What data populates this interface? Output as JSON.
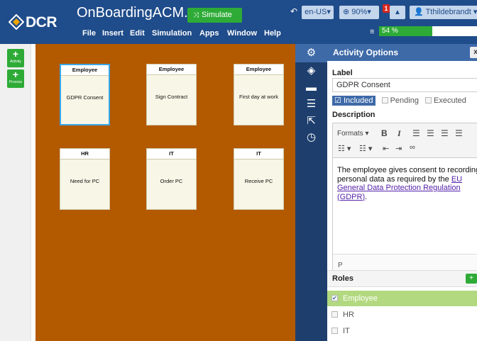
{
  "app": {
    "logo_text": "DCR",
    "title": "OnBoardingACM...",
    "simulate_label": "Simulate"
  },
  "menu": [
    "File",
    "Insert",
    "Edit",
    "Simulation",
    "Apps",
    "Window",
    "Help"
  ],
  "topbar": {
    "language": "en-US",
    "zoom": "90%",
    "notification_count": "1",
    "user": "Tthildebrandt",
    "progress_label": "54 %",
    "progress_value": 0.54
  },
  "left_tools": [
    {
      "label": "Activity"
    },
    {
      "label": "Process"
    }
  ],
  "activities": [
    {
      "role": "Employee",
      "label": "GDPR Consent",
      "selected": true
    },
    {
      "role": "Employee",
      "label": "Sign Contract",
      "selected": false
    },
    {
      "role": "Employee",
      "label": "First day at work",
      "selected": false
    },
    {
      "role": "HR",
      "label": "Need for PC",
      "selected": false
    },
    {
      "role": "IT",
      "label": "Order PC",
      "selected": false
    },
    {
      "role": "IT",
      "label": "Receive PC",
      "selected": false
    }
  ],
  "icon_column": [
    {
      "name": "gear-icon",
      "glyph": "⚙"
    },
    {
      "name": "hidden-eye-icon",
      "glyph": "◈"
    },
    {
      "name": "comment-icon",
      "glyph": "▬"
    },
    {
      "name": "list-icon",
      "glyph": "☰"
    },
    {
      "name": "share-icon",
      "glyph": "⇱"
    },
    {
      "name": "clock-icon",
      "glyph": "◷"
    }
  ],
  "panel": {
    "title": "Activity Options",
    "close_label": "x",
    "label_heading": "Label",
    "label_value": "GDPR Consent",
    "included_label": "Included",
    "included_checked": true,
    "pending_label": "Pending",
    "executed_label": "Executed",
    "description_heading": "Description",
    "formats_label": "Formats",
    "description_text": "The employee gives consent to recording personal data as required by the ",
    "description_link": "EU General Data Protection Regulation (GDPR)",
    "description_end": ".",
    "status_path": "P",
    "roles_heading": "Roles",
    "roles_add_label": "+",
    "roles": [
      {
        "name": "Employee",
        "checked": true
      },
      {
        "name": "HR",
        "checked": false
      },
      {
        "name": "IT",
        "checked": false
      }
    ]
  },
  "colors": {
    "topbar": "#1f4c8a",
    "accent_green": "#2eab37",
    "canvas": "#b35900",
    "panel_header": "#3e6aa8",
    "icon_column": "#1e3f6e"
  }
}
